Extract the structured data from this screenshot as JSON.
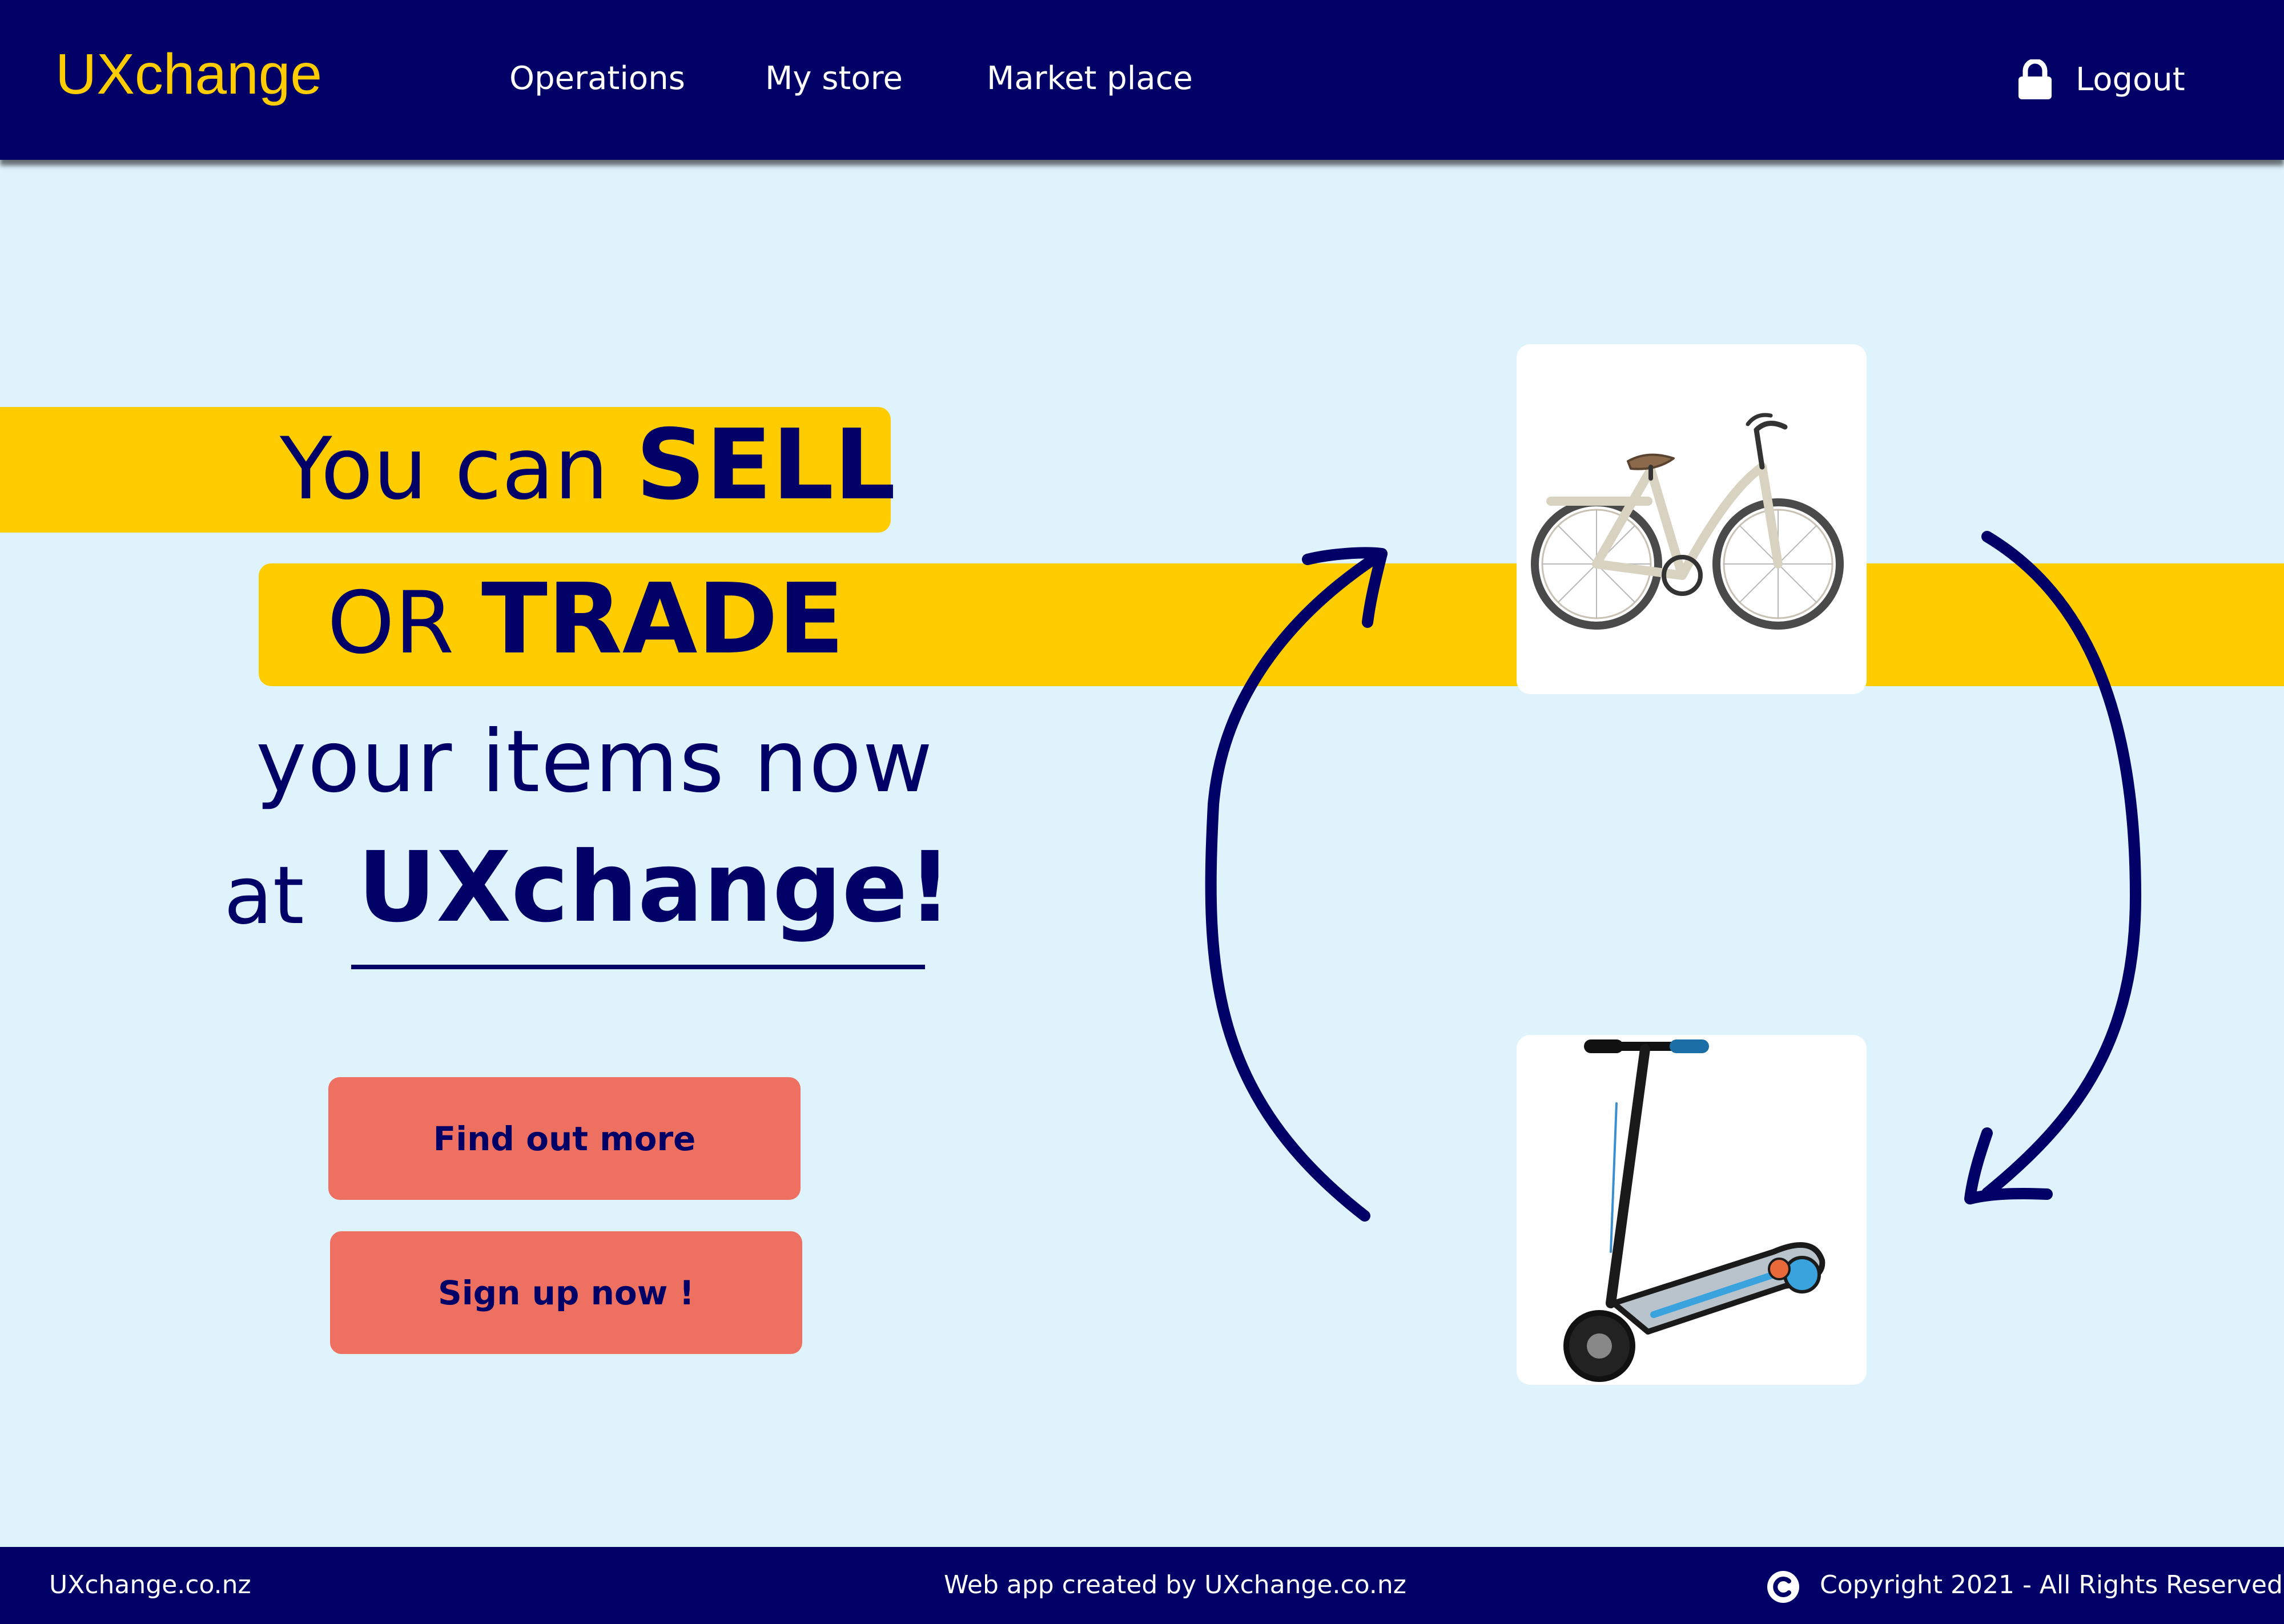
{
  "header": {
    "brand": "UXchange",
    "nav": [
      "Operations",
      "My store",
      "Market place"
    ],
    "logout_label": "Logout",
    "logout_icon": "lock-icon"
  },
  "hero": {
    "line1_prefix": "You can ",
    "line1_bold": "SELL",
    "line2_prefix": "OR ",
    "line2_bold": "TRADE",
    "line3": "your items now",
    "line4_prefix": "at",
    "line4_bold": "UXchange!"
  },
  "buttons": {
    "find_out_more": "Find out more",
    "sign_up": "Sign up now !"
  },
  "products": [
    {
      "name": "bicycle",
      "icon": "bicycle-image"
    },
    {
      "name": "electric scooter",
      "icon": "scooter-image"
    }
  ],
  "footer": {
    "left": "UXchange.co.nz",
    "center": "Web app created by UXchange.co.nz",
    "right": "Copyright 2021 - All Rights Reserved",
    "icon": "copyright-icon"
  },
  "colors": {
    "navy": "#000066",
    "yellow": "#ffcc00",
    "background": "#dff3fd",
    "button": "#ee7060"
  }
}
